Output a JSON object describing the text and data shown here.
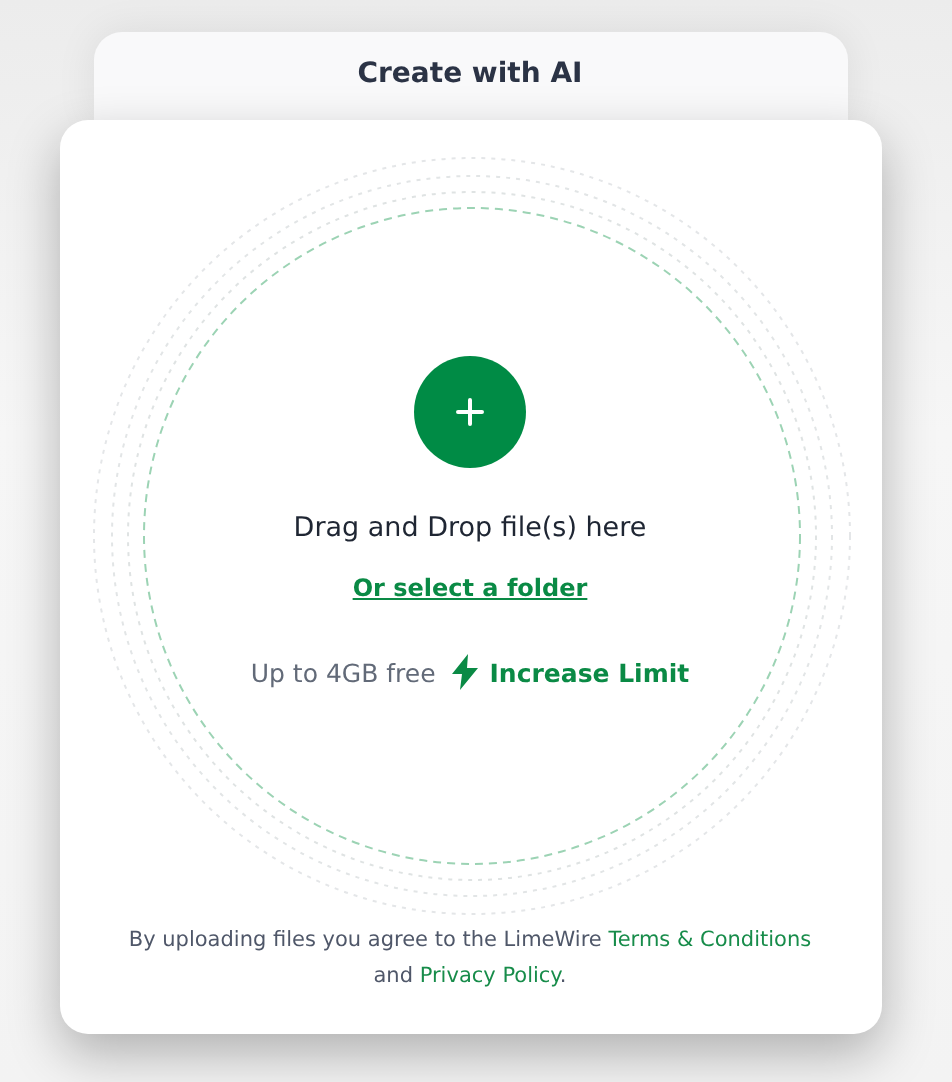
{
  "back_tab": {
    "title": "Create with AI"
  },
  "upload": {
    "heading": "Drag and Drop file(s) here",
    "folder_link": "Or select a folder",
    "limit_text": "Up to 4GB free",
    "increase_link": "Increase Limit"
  },
  "footer": {
    "before": "By uploading files you agree to the LimeWire ",
    "terms_link": "Terms & Conditions",
    "middle": " and ",
    "privacy_link": "Privacy Policy",
    "after": "."
  }
}
